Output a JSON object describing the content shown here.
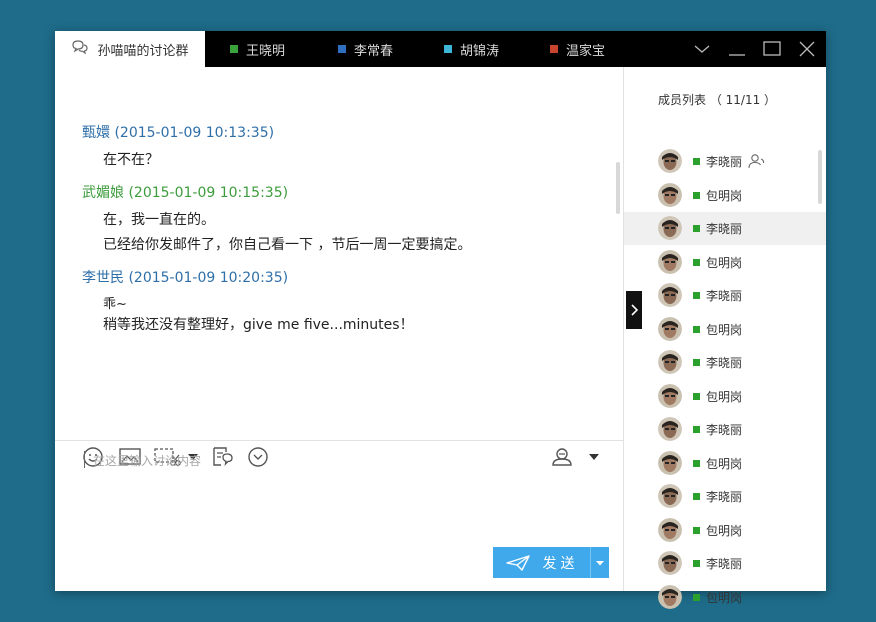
{
  "tabs": [
    {
      "label": "孙喵喵的讨论群",
      "active": true
    },
    {
      "label": "王晓明",
      "color": "#3aa23a"
    },
    {
      "label": "李常春",
      "color": "#2f6fbf"
    },
    {
      "label": "胡锦涛",
      "color": "#3fb6d8"
    },
    {
      "label": "温家宝",
      "color": "#c8442f"
    }
  ],
  "messages": [
    {
      "sender": "甄嬛",
      "time": "(2015-01-09 10:13:35)",
      "color": "#2f6fa8",
      "lines": [
        "在不在？"
      ]
    },
    {
      "sender": "武媚娘",
      "time": "(2015-01-09 10:15:35)",
      "color": "#3d9c3d",
      "lines": [
        "在，我一直在的。",
        "已经给你发邮件了，你自己看一下 ，节后一周一定要搞定。"
      ]
    },
    {
      "sender": "李世民",
      "time": "(2015-01-09 10:20:35)",
      "color": "#2f6fa8",
      "lines": [
        "乖~",
        "稍等我还没有整理好，give me five...minutes！"
      ]
    }
  ],
  "input": {
    "placeholder": "在这里输入讨论内容"
  },
  "send": {
    "label": "发送"
  },
  "members": {
    "title": "成员列表",
    "count": "（ 11/11 ）",
    "list": [
      {
        "name": "李晓丽",
        "admin": true
      },
      {
        "name": "包明岗"
      },
      {
        "name": "李晓丽",
        "highlight": true
      },
      {
        "name": "包明岗"
      },
      {
        "name": "李晓丽"
      },
      {
        "name": "包明岗"
      },
      {
        "name": "李晓丽"
      },
      {
        "name": "包明岗"
      },
      {
        "name": "李晓丽"
      },
      {
        "name": "包明岗"
      },
      {
        "name": "李晓丽"
      },
      {
        "name": "包明岗"
      },
      {
        "name": "李晓丽"
      },
      {
        "name": "包明岗"
      }
    ]
  },
  "colors": {
    "accent": "#3fa9ec",
    "titlebar": "#000000",
    "online": "#2ca02c",
    "background": "#1e6c8a"
  }
}
